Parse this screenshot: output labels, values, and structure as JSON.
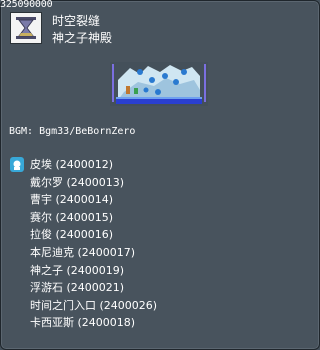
{
  "map_id": "325090000",
  "street_name": "时空裂缝",
  "map_name": "神之子神殿",
  "bgm_text": "BGM: Bgm33/BeBornZero",
  "icons": {
    "map": "hourglass-map-icon",
    "npc": "npc-head-icon"
  },
  "npcs": [
    {
      "name": "皮埃 (2400012)"
    },
    {
      "name": "戴尔罗 (2400013)"
    },
    {
      "name": "曹宇 (2400014)"
    },
    {
      "name": "赛尔 (2400015)"
    },
    {
      "name": "拉俊 (2400016)"
    },
    {
      "name": "本尼迪克 (2400017)"
    },
    {
      "name": "神之子 (2400019)"
    },
    {
      "name": "浮游石 (2400021)"
    },
    {
      "name": "时间之门入口 (2400026)"
    },
    {
      "name": "卡西亚斯 (2400018)"
    }
  ]
}
